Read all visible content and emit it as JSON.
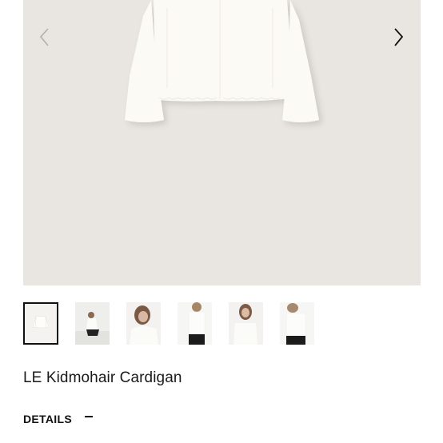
{
  "product": {
    "title": "LE Kidmohair Cardigan",
    "colors": {
      "gallery_bg": "#e9e6e1",
      "garment": "#fbfaf5",
      "text": "#1a1a1a"
    }
  },
  "gallery": {
    "prev_icon": "chevron-left-icon",
    "next_icon": "chevron-right-icon",
    "thumbnails": [
      {
        "subject": "cardigan flat lay",
        "active": true
      },
      {
        "subject": "model crouching",
        "active": false
      },
      {
        "subject": "model close-up",
        "active": false
      },
      {
        "subject": "model standing front",
        "active": false
      },
      {
        "subject": "model hand on collar",
        "active": false
      },
      {
        "subject": "model standing side",
        "active": false
      }
    ]
  },
  "details": {
    "label": "DETAILS",
    "toggle_icon": "minus-icon"
  }
}
